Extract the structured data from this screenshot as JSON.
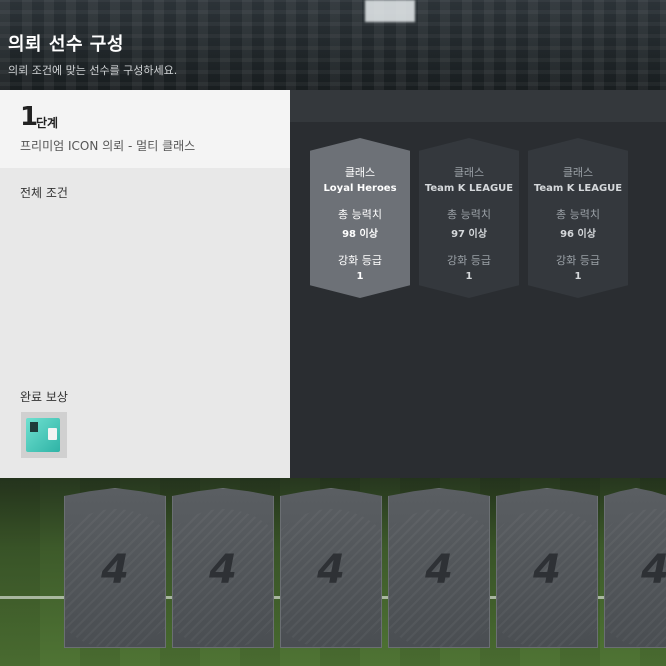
{
  "header": {
    "title": "의뢰 선수 구성",
    "subtitle": "의뢰 조건에 맞는 선수를 구성하세요."
  },
  "step": {
    "number": "1",
    "word": "단계",
    "description": "프리미엄 ICON 의뢰 - 멀티 클래스"
  },
  "conditions_label": "전체 조건",
  "reward_label": "완료 보상",
  "reward_icon": "teal-player-pack-icon",
  "condition_cards": [
    {
      "class_label": "클래스",
      "class_value": "Loyal Heroes",
      "ovr_label": "총 능력치",
      "ovr_value": "98 이상",
      "grade_label": "강화 등급",
      "grade_value": "1",
      "state": "active"
    },
    {
      "class_label": "클래스",
      "class_value": "Team K LEAGUE",
      "ovr_label": "총 능력치",
      "ovr_value": "97 이상",
      "grade_label": "강화 등급",
      "grade_value": "1",
      "state": "inactive"
    },
    {
      "class_label": "클래스",
      "class_value": "Team K LEAGUE",
      "ovr_label": "총 능력치",
      "ovr_value": "96 이상",
      "grade_label": "강화 등급",
      "grade_value": "1",
      "state": "inactive"
    }
  ],
  "player_slots": [
    "4",
    "4",
    "4",
    "4",
    "4",
    "4"
  ]
}
